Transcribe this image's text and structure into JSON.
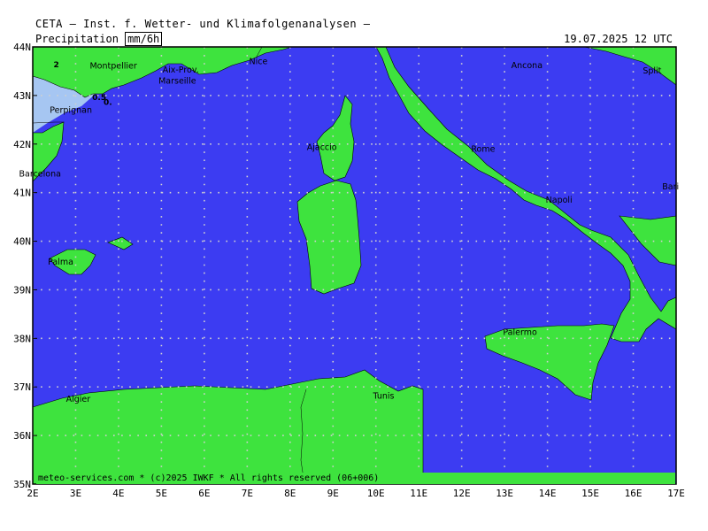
{
  "header": {
    "title": "CETA — Inst. f. Wetter- und Klimafolgenanalysen —",
    "variable": "Precipitation",
    "unit": "mm/6h",
    "valid_time": "19.07.2025 12 UTC"
  },
  "map": {
    "lon_range": [
      2,
      17
    ],
    "lat_range": [
      35,
      44
    ],
    "lon_ticks": [
      "2E",
      "3E",
      "4E",
      "5E",
      "6E",
      "7E",
      "8E",
      "9E",
      "10E",
      "11E",
      "12E",
      "13E",
      "14E",
      "15E",
      "16E",
      "17E"
    ],
    "lat_ticks": [
      "35N",
      "36N",
      "37N",
      "38N",
      "39N",
      "40N",
      "41N",
      "42N",
      "43N",
      "44N"
    ],
    "colors": {
      "sea": "#3c3cf2",
      "land": "#3ee33e",
      "grid": "#d0d0d0",
      "precip_light": "#a6c6f2",
      "precip_mid": "#8f7cf0",
      "precip_heavy": "#b35ad8"
    },
    "cities": [
      {
        "name": "Montpellier",
        "lon": 3.88,
        "lat": 43.61
      },
      {
        "name": "Aix-Prov.",
        "lon": 5.45,
        "lat": 43.53
      },
      {
        "name": "Nice",
        "lon": 7.26,
        "lat": 43.7
      },
      {
        "name": "Marseille",
        "lon": 5.37,
        "lat": 43.3
      },
      {
        "name": "Perpignan",
        "lon": 2.89,
        "lat": 42.7
      },
      {
        "name": "Barcelona",
        "lon": 2.17,
        "lat": 41.39
      },
      {
        "name": "Ajaccio",
        "lon": 8.74,
        "lat": 41.93
      },
      {
        "name": "Rome",
        "lon": 12.5,
        "lat": 41.9
      },
      {
        "name": "Ancona",
        "lon": 13.52,
        "lat": 43.62
      },
      {
        "name": "Split",
        "lon": 16.44,
        "lat": 43.51
      },
      {
        "name": "Napoli",
        "lon": 14.27,
        "lat": 40.85
      },
      {
        "name": "Bari",
        "lon": 16.87,
        "lat": 41.12
      },
      {
        "name": "Palma",
        "lon": 2.65,
        "lat": 39.57
      },
      {
        "name": "Palermo",
        "lon": 13.36,
        "lat": 38.12
      },
      {
        "name": "Algier",
        "lon": 3.06,
        "lat": 36.75
      },
      {
        "name": "Tunis",
        "lon": 10.18,
        "lat": 36.81
      }
    ],
    "contour_labels": [
      {
        "text": "2",
        "lon": 2.55,
        "lat": 43.64
      },
      {
        "text": "0.5",
        "lon": 3.55,
        "lat": 42.96
      },
      {
        "text": "0.",
        "lon": 3.75,
        "lat": 42.86
      }
    ]
  },
  "footer": {
    "text": "meteo-services.com * (c)2025 IWKF * All rights reserved (06+006)"
  }
}
